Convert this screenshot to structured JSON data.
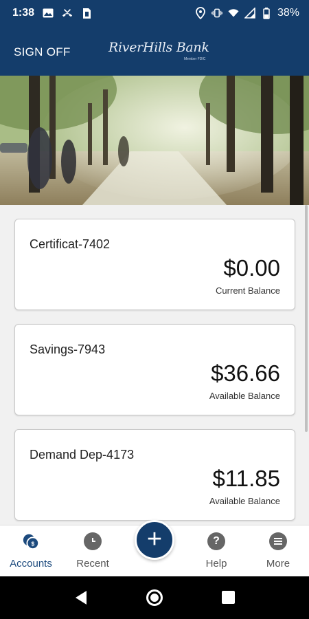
{
  "status_bar": {
    "time": "1:38",
    "battery": "38%",
    "left_icons": [
      "image-icon",
      "missed-call-icon",
      "sim-card-icon"
    ],
    "right_icons": [
      "location-icon",
      "vibrate-icon",
      "wifi-icon",
      "signal-icon",
      "battery-icon"
    ]
  },
  "header": {
    "sign_off": "SIGN OFF",
    "logo": "RiverHills Bank",
    "logo_sub": "Member FDIC",
    "background": "#143d6b"
  },
  "accounts": [
    {
      "name": "Certificat-7402",
      "amount": "$0.00",
      "label": "Current Balance"
    },
    {
      "name": "Savings-7943",
      "amount": "$36.66",
      "label": "Available Balance"
    },
    {
      "name": "Demand Dep-4173",
      "amount": "$11.85",
      "label": "Available Balance"
    }
  ],
  "bottom_nav": {
    "items": [
      {
        "label": "Accounts",
        "icon": "accounts-icon",
        "active": true
      },
      {
        "label": "Recent",
        "icon": "clock-icon"
      },
      {
        "label": "Help",
        "icon": "help-icon",
        "glyph": "?"
      },
      {
        "label": "More",
        "icon": "menu-icon"
      }
    ],
    "fab_icon": "plus-icon",
    "active_color": "#1c4a7d"
  }
}
